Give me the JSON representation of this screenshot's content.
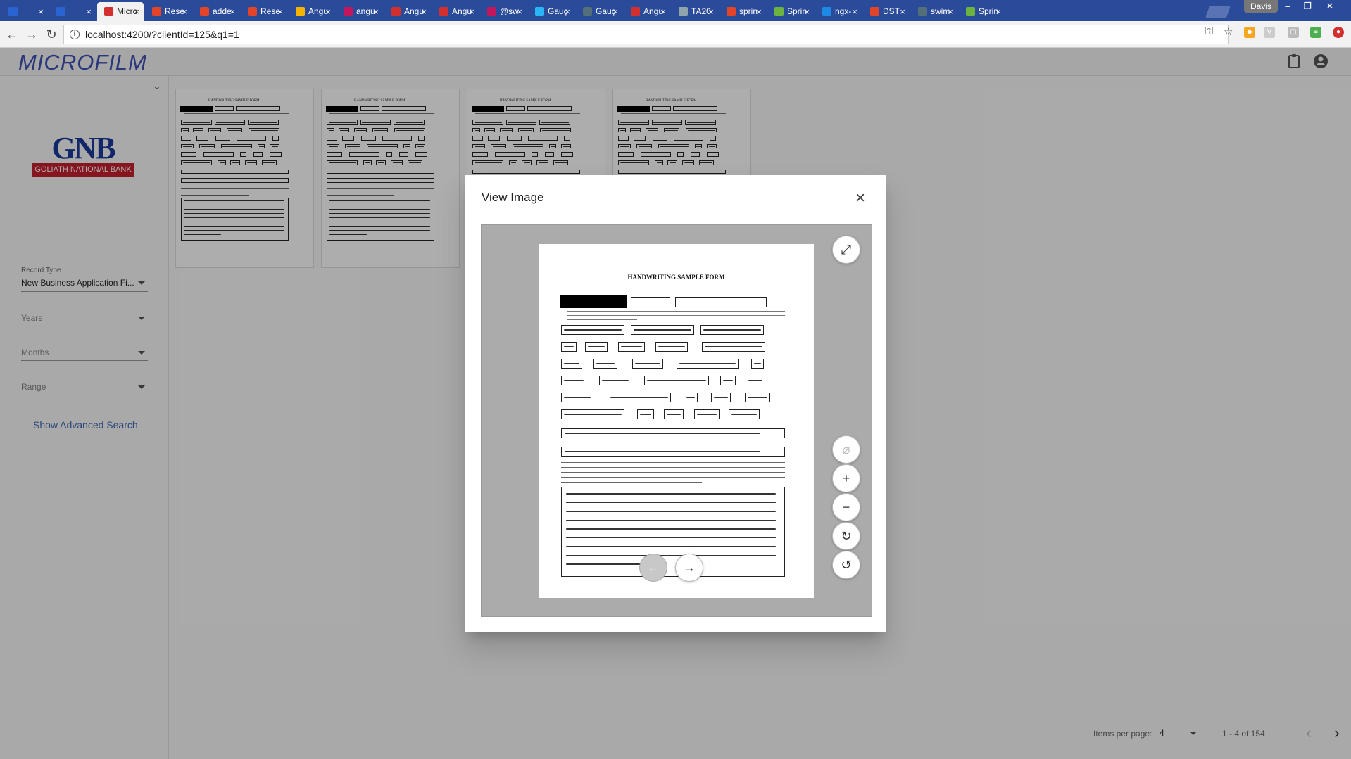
{
  "browser": {
    "tabs": [
      {
        "label": "",
        "color": "#2a63d4",
        "active": false
      },
      {
        "label": "",
        "color": "#2a63d4",
        "active": false
      },
      {
        "label": "Micro",
        "color": "#d32f2f",
        "active": true
      },
      {
        "label": "Rese",
        "color": "#e24329",
        "active": false
      },
      {
        "label": "adde",
        "color": "#e24329",
        "active": false
      },
      {
        "label": "Rese",
        "color": "#e24329",
        "active": false
      },
      {
        "label": "Angu",
        "color": "#f4b400",
        "active": false
      },
      {
        "label": "angu",
        "color": "#c2185b",
        "active": false
      },
      {
        "label": "Angu",
        "color": "#d32f2f",
        "active": false
      },
      {
        "label": "Angu",
        "color": "#d32f2f",
        "active": false
      },
      {
        "label": "@sw",
        "color": "#c2185b",
        "active": false
      },
      {
        "label": "Gauç",
        "color": "#29b6f6",
        "active": false
      },
      {
        "label": "Gauç",
        "color": "#546e7a",
        "active": false
      },
      {
        "label": "Angu",
        "color": "#d32f2f",
        "active": false
      },
      {
        "label": "TA20",
        "color": "#90a4ae",
        "active": false
      },
      {
        "label": "sprin",
        "color": "#e24329",
        "active": false
      },
      {
        "label": "Sprin",
        "color": "#6db33f",
        "active": false
      },
      {
        "label": "ngx-",
        "color": "#1e88e5",
        "active": false
      },
      {
        "label": "DST",
        "color": "#e24329",
        "active": false
      },
      {
        "label": "swim",
        "color": "#546e7a",
        "active": false
      },
      {
        "label": "Sprin",
        "color": "#6db33f",
        "active": false
      }
    ],
    "user": "Davis",
    "url": "localhost:4200/?clientId=125&q1=1"
  },
  "app": {
    "title": "MICROFILM"
  },
  "sidebar": {
    "logo_text": "GNB",
    "logo_subtext": "GOLIATH NATIONAL BANK",
    "record_type": {
      "label": "Record Type",
      "value": "New Business Application Fi..."
    },
    "years": {
      "placeholder": "Years"
    },
    "months": {
      "placeholder": "Months"
    },
    "range": {
      "placeholder": "Range"
    },
    "advanced_search": "Show Advanced Search"
  },
  "paginator": {
    "items_per_page_label": "Items per page:",
    "items_per_page": "4",
    "range_label": "1 - 4 of 154"
  },
  "dialog": {
    "title": "View Image",
    "close": "×"
  },
  "form": {
    "title": "HANDWRITING SAMPLE FORM"
  },
  "colors": {
    "accent": "#3f51b5",
    "brand_red": "#c8202f",
    "brand_blue": "#1b3a9b"
  }
}
